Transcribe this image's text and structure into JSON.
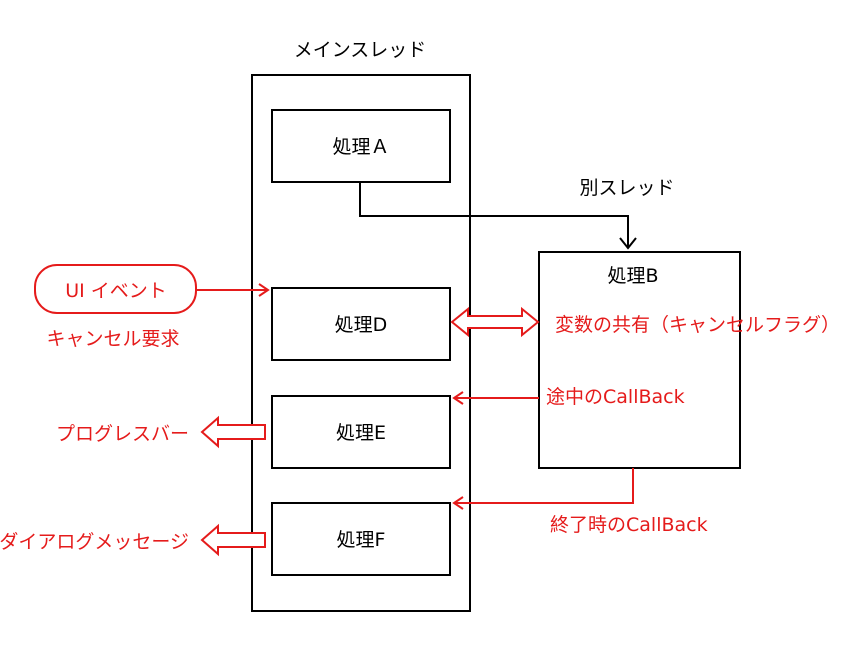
{
  "colors": {
    "accent": "#e51b1b",
    "line": "#000000",
    "background": "#ffffff"
  },
  "main_thread": {
    "label": "メインスレッド",
    "process_a": "処理Ａ",
    "process_d": "処理D",
    "process_e": "処理E",
    "process_f": "処理F"
  },
  "other_thread": {
    "label": "別スレッド",
    "process_b": "処理B"
  },
  "ui_event": {
    "label": "UI イベント",
    "caption": "キャンセル要求"
  },
  "annotations": {
    "shared_variable": "変数の共有（キャンセルフラグ）",
    "midway_callback": "途中のCallBack",
    "end_callback": "終了時のCallBack",
    "progress_bar": "プログレスバー",
    "dialog_message": "ダイアログメッセージ"
  }
}
